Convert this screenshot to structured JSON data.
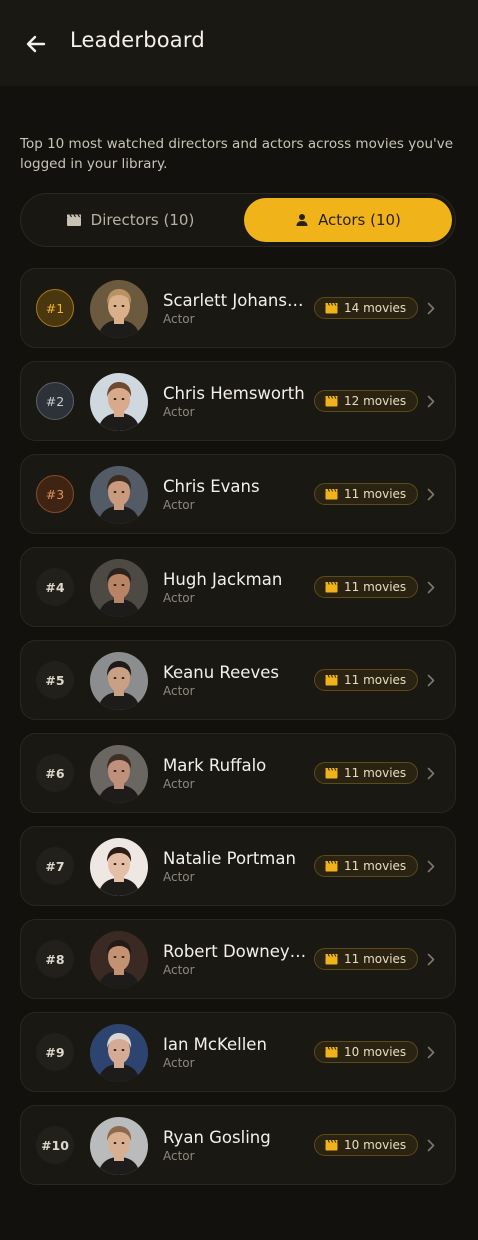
{
  "header": {
    "title": "Leaderboard"
  },
  "description": "Top 10 most watched directors and actors across movies you've logged in your library.",
  "tabs": {
    "directors_label": "Directors (10)",
    "actors_label": "Actors (10)",
    "active": "actors"
  },
  "colors": {
    "accent": "#f0b41a",
    "background": "#13110d",
    "card": "#1a1813"
  },
  "rows": [
    {
      "rank": "#1",
      "tier": "gold",
      "name": "Scarlett Johansson",
      "role": "Actor",
      "movies": "14 movies",
      "skin": "#d9b089",
      "hair": "#b89262",
      "bg": "#6c5a3e"
    },
    {
      "rank": "#2",
      "tier": "silver",
      "name": "Chris Hemsworth",
      "role": "Actor",
      "movies": "12 movies",
      "skin": "#d8a98a",
      "hair": "#6e4a30",
      "bg": "#cfd8df"
    },
    {
      "rank": "#3",
      "tier": "bronze",
      "name": "Chris Evans",
      "role": "Actor",
      "movies": "11 movies",
      "skin": "#c99a7d",
      "hair": "#3d2c21",
      "bg": "#525b66"
    },
    {
      "rank": "#4",
      "tier": "plain",
      "name": "Hugh Jackman",
      "role": "Actor",
      "movies": "11 movies",
      "skin": "#b98466",
      "hair": "#2c221c",
      "bg": "#4d4a43"
    },
    {
      "rank": "#5",
      "tier": "plain",
      "name": "Keanu Reeves",
      "role": "Actor",
      "movies": "11 movies",
      "skin": "#caa084",
      "hair": "#1d1a17",
      "bg": "#8b8d8e"
    },
    {
      "rank": "#6",
      "tier": "plain",
      "name": "Mark Ruffalo",
      "role": "Actor",
      "movies": "11 movies",
      "skin": "#c0917a",
      "hair": "#3e2f27",
      "bg": "#6a6762"
    },
    {
      "rank": "#7",
      "tier": "plain",
      "name": "Natalie Portman",
      "role": "Actor",
      "movies": "11 movies",
      "skin": "#e5bea7",
      "hair": "#2a1d17",
      "bg": "#efe7e2"
    },
    {
      "rank": "#8",
      "tier": "plain",
      "name": "Robert Downey Jr.",
      "role": "Actor",
      "movies": "11 movies",
      "skin": "#c39273",
      "hair": "#241a15",
      "bg": "#3b2a24"
    },
    {
      "rank": "#9",
      "tier": "plain",
      "name": "Ian McKellen",
      "role": "Actor",
      "movies": "10 movies",
      "skin": "#d6ab95",
      "hair": "#d9d6d2",
      "bg": "#2d4470"
    },
    {
      "rank": "#10",
      "tier": "plain",
      "name": "Ryan Gosling",
      "role": "Actor",
      "movies": "10 movies",
      "skin": "#d8af91",
      "hair": "#8c6b4c",
      "bg": "#b9bbbc"
    }
  ]
}
